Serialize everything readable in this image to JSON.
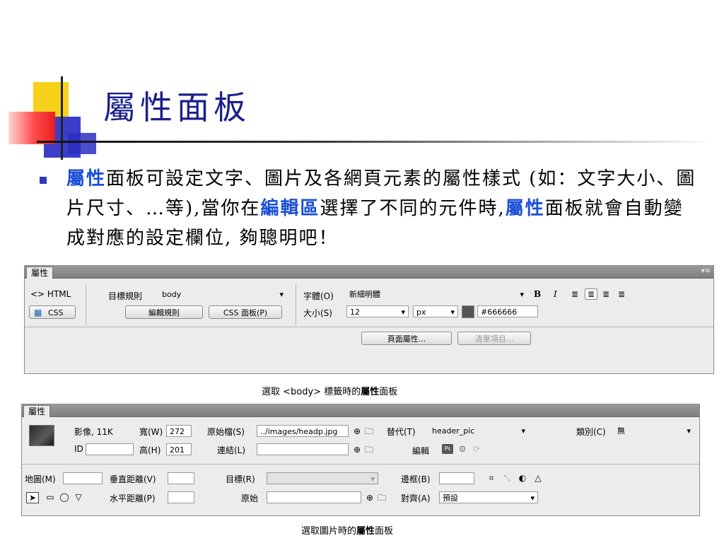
{
  "slide": {
    "title": "屬性面板",
    "bullet": {
      "hl1": "屬性",
      "t1": "面板可設定文字、圖片及各網頁元素的屬性樣式 (如：文字大小、圖片尺寸、…等),當你在",
      "hl2": "編輯區",
      "t2": "選擇了不同的元件時,",
      "hl3": "屬性",
      "t3": "面板就會自動變成對應的設定欄位, 夠聰明吧！"
    }
  },
  "panel_body": {
    "tab": "屬性",
    "html_btn": "<> HTML",
    "css_btn": "CSS",
    "target_rule_label": "目標規則",
    "target_rule_value": "body",
    "edit_rule_btn": "編輯規則",
    "css_panel_btn": "CSS 面板(P)",
    "font_label": "字體(O)",
    "font_value": "新細明體",
    "size_label": "大小(S)",
    "size_value": "12",
    "unit_value": "px",
    "color_value": "#666666",
    "bold": "B",
    "italic": "I",
    "page_props_btn": "頁面屬性...",
    "list_item_btn": "清單項目...",
    "caption_pre": "選取 <body> 標籤時的",
    "caption_bold": "屬性",
    "caption_post": "面板"
  },
  "panel_img": {
    "tab": "屬性",
    "image_label": "影像, 11K",
    "width_label": "寬(W)",
    "width_value": "272",
    "height_label": "高(H)",
    "height_value": "201",
    "id_label": "ID",
    "src_label": "原始檔(S)",
    "src_value": "../images/headp.jpg",
    "link_label": "連結(L)",
    "alt_label": "替代(T)",
    "alt_value": "header_pic",
    "edit_label": "編輯",
    "class_label": "類別(C)",
    "class_value": "無",
    "map_label": "地圖(M)",
    "vspace_label": "垂直距離(V)",
    "hspace_label": "水平距離(P)",
    "target_label": "目標(R)",
    "original_label": "原始",
    "border_label": "邊框(B)",
    "align_label": "對齊(A)",
    "align_value": "預設",
    "ps_icon": "Ps",
    "caption_pre": "選取圖片時的",
    "caption_bold": "屬性",
    "caption_post": "面板"
  }
}
